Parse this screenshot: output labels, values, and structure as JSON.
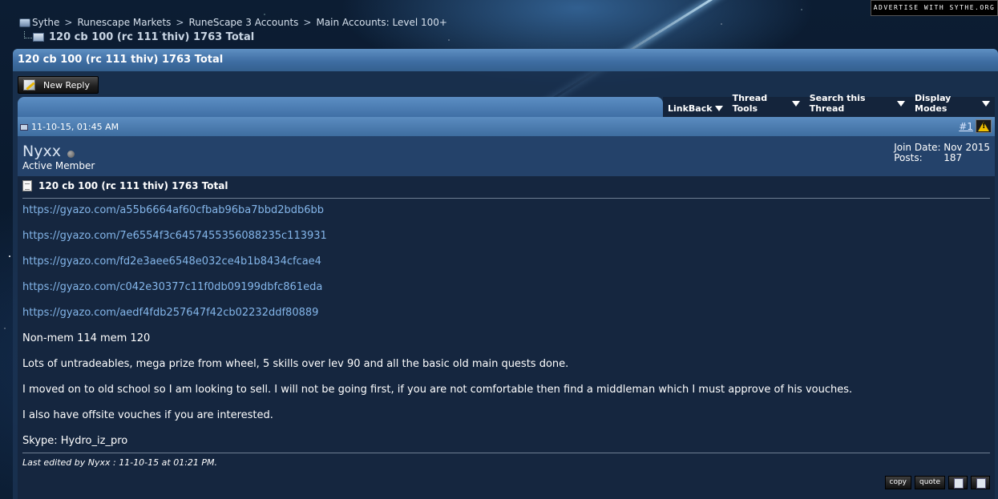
{
  "advertise": "ADVERTISE WITH SYTHE.ORG",
  "breadcrumb": {
    "items": [
      "Sythe",
      "Runescape Markets",
      "RuneScape 3 Accounts",
      "Main Accounts: Level 100+"
    ],
    "separator": ">",
    "current": "120 cb 100 (rc 111 thiv) 1763 Total"
  },
  "thread": {
    "title": "120 cb 100 (rc 111 thiv) 1763 Total",
    "new_reply_label": "New Reply",
    "tools": [
      "LinkBack",
      "Thread Tools",
      "Search this Thread",
      "Display Modes"
    ]
  },
  "post": {
    "date": "11-10-15, 01:45 AM",
    "number": "#1",
    "username": "Nyxx",
    "user_title": "Active Member",
    "join_date_label": "Join Date:",
    "join_date": "Nov 2015",
    "posts_label": "Posts:",
    "posts": "187",
    "title": "120 cb 100 (rc 111 thiv) 1763 Total",
    "links": [
      "https://gyazo.com/a55b6664af60cfbab96ba7bbd2bdb6bb",
      "https://gyazo.com/7e6554f3c6457455356088235c113931",
      "https://gyazo.com/fd2e3aee6548e032ce4b1b8434cfcae4",
      "https://gyazo.com/c042e30377c11f0db09199dbfc861eda",
      "https://gyazo.com/aedf4fdb257647f42cb02232ddf80889"
    ],
    "paragraphs": [
      "Non-mem 114 mem 120",
      "Lots of untradeables, mega prize from wheel, 5 skills over lev 90 and all the basic old main quests done.",
      "I moved on to old school so I am looking to sell. I will not be going first, if you are not comfortable then find a middleman which I must approve of his vouches.",
      "I also have offsite vouches if you are interested.",
      "Skype: Hydro_iz_pro"
    ],
    "last_edited": "Last edited by Nyxx : 11-10-15 at 01:21 PM.",
    "buttons": {
      "copy": "copy",
      "quote": "quote"
    }
  },
  "colors": {
    "header_blue": "#4a7bb0",
    "link": "#84b6ea",
    "content_bg": "#15263f"
  }
}
